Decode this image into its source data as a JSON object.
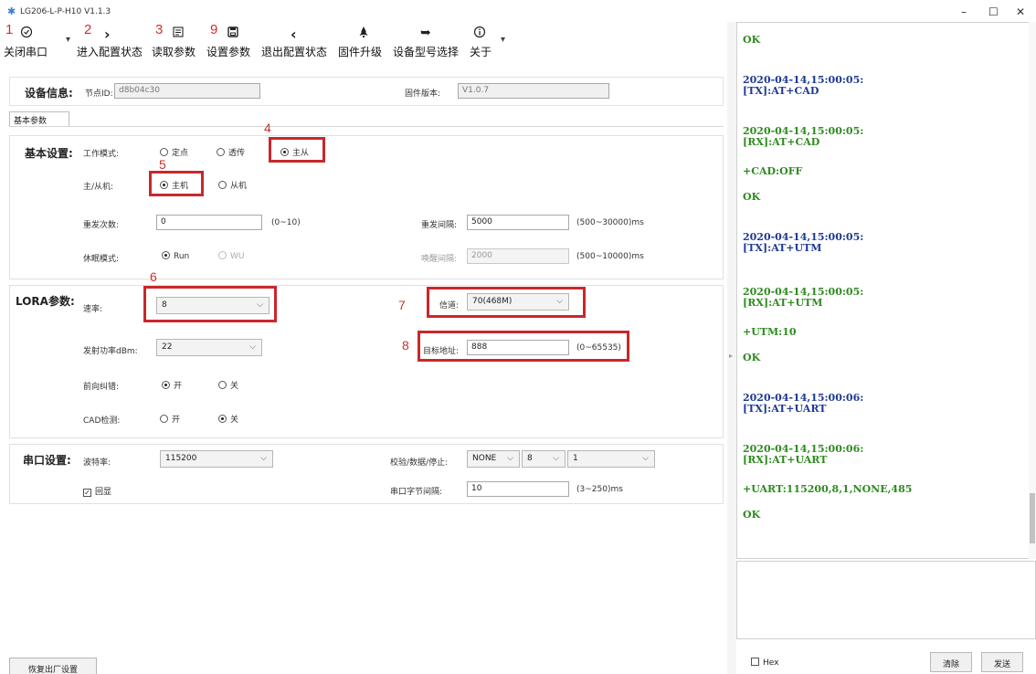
{
  "window": {
    "title": "LG206-L-P-H10 V1.1.3",
    "minimize": "–",
    "maximize": "☐",
    "close": "✕"
  },
  "toolbar": {
    "items": [
      {
        "num": "1",
        "label": "关闭串口"
      },
      {
        "num": "2",
        "label": "进入配置状态"
      },
      {
        "num": "3",
        "label": "读取参数"
      },
      {
        "num": "9",
        "label": "设置参数"
      },
      {
        "num": "",
        "label": "退出配置状态"
      },
      {
        "num": "",
        "label": "固件升级"
      },
      {
        "num": "",
        "label": "设备型号选择"
      },
      {
        "num": "",
        "label": "关于"
      }
    ]
  },
  "device_info": {
    "title": "设备信息:",
    "node_id_label": "节点ID:",
    "node_id": "d8b04c30",
    "firmware_label": "固件版本:",
    "firmware": "V1.0.7"
  },
  "tab": {
    "label": "基本参数"
  },
  "basic": {
    "title": "基本设置:",
    "work_mode_label": "工作模式:",
    "work_modes": [
      "定点",
      "透传",
      "主从"
    ],
    "work_mode_selected": "主从",
    "master_slave_label": "主/从机:",
    "master_slave": [
      "主机",
      "从机"
    ],
    "master_slave_selected": "主机",
    "retry_label": "重发次数:",
    "retry_value": "0",
    "retry_range": "(0~10)",
    "retry_interval_label": "重发间隔:",
    "retry_interval_value": "5000",
    "retry_interval_range": "(500~30000)ms",
    "sleep_label": "休眠模式:",
    "sleep_modes": [
      "Run",
      "WU"
    ],
    "sleep_selected": "Run",
    "wake_label": "唤醒间隔:",
    "wake_value": "2000",
    "wake_range": "(500~10000)ms"
  },
  "lora": {
    "title": "LORA参数:",
    "rate_label": "速率:",
    "rate_value": "8",
    "channel_label": "信道:",
    "channel_value": "70(468M)",
    "power_label": "发射功率dBm:",
    "power_value": "22",
    "target_label": "目标地址:",
    "target_value": "888",
    "target_range": "(0~65535)",
    "fec_label": "前向纠错:",
    "fec_options": [
      "开",
      "关"
    ],
    "fec_selected": "开",
    "cad_label": "CAD检测:",
    "cad_options": [
      "开",
      "关"
    ],
    "cad_selected": "关"
  },
  "serial": {
    "title": "串口设置:",
    "baud_label": "波特率:",
    "baud_value": "115200",
    "parity_label": "校验/数据/停止:",
    "parity_value": "NONE",
    "data_bits": "8",
    "stop_bits": "1",
    "echo_label": "回显",
    "echo_checked": true,
    "byte_interval_label": "串口字节间隔:",
    "byte_interval_value": "10",
    "byte_interval_range": "(3~250)ms"
  },
  "annotations": [
    "4",
    "5",
    "6",
    "7",
    "8"
  ],
  "restore_label": "恢复出厂设置",
  "log": [
    {
      "text": "OK",
      "kind": "rx"
    },
    {
      "text": "2020-04-14,15:00:05:",
      "kind": "tx"
    },
    {
      "text": "[TX]:AT+CAD",
      "kind": "tx"
    },
    {
      "text": "2020-04-14,15:00:05:",
      "kind": "rx"
    },
    {
      "text": "[RX]:AT+CAD",
      "kind": "rx"
    },
    {
      "text": "+CAD:OFF",
      "kind": "rx"
    },
    {
      "text": "OK",
      "kind": "rx"
    },
    {
      "text": "2020-04-14,15:00:05:",
      "kind": "tx"
    },
    {
      "text": "[TX]:AT+UTM",
      "kind": "tx"
    },
    {
      "text": "2020-04-14,15:00:05:",
      "kind": "rx"
    },
    {
      "text": "[RX]:AT+UTM",
      "kind": "rx"
    },
    {
      "text": "+UTM:10",
      "kind": "rx"
    },
    {
      "text": "OK",
      "kind": "rx"
    },
    {
      "text": "2020-04-14,15:00:06:",
      "kind": "tx"
    },
    {
      "text": "[TX]:AT+UART",
      "kind": "tx"
    },
    {
      "text": "2020-04-14,15:00:06:",
      "kind": "rx"
    },
    {
      "text": "[RX]:AT+UART",
      "kind": "rx"
    },
    {
      "text": "+UART:115200,8,1,NONE,485",
      "kind": "rx"
    },
    {
      "text": "OK",
      "kind": "rx"
    }
  ],
  "log_colors": {
    "tx": "#1f3a93",
    "rx": "#2e8b1f"
  },
  "bottom": {
    "hex_label": "Hex",
    "clear_label": "清除",
    "send_label": "发送"
  },
  "accent_red": "#c8282b"
}
